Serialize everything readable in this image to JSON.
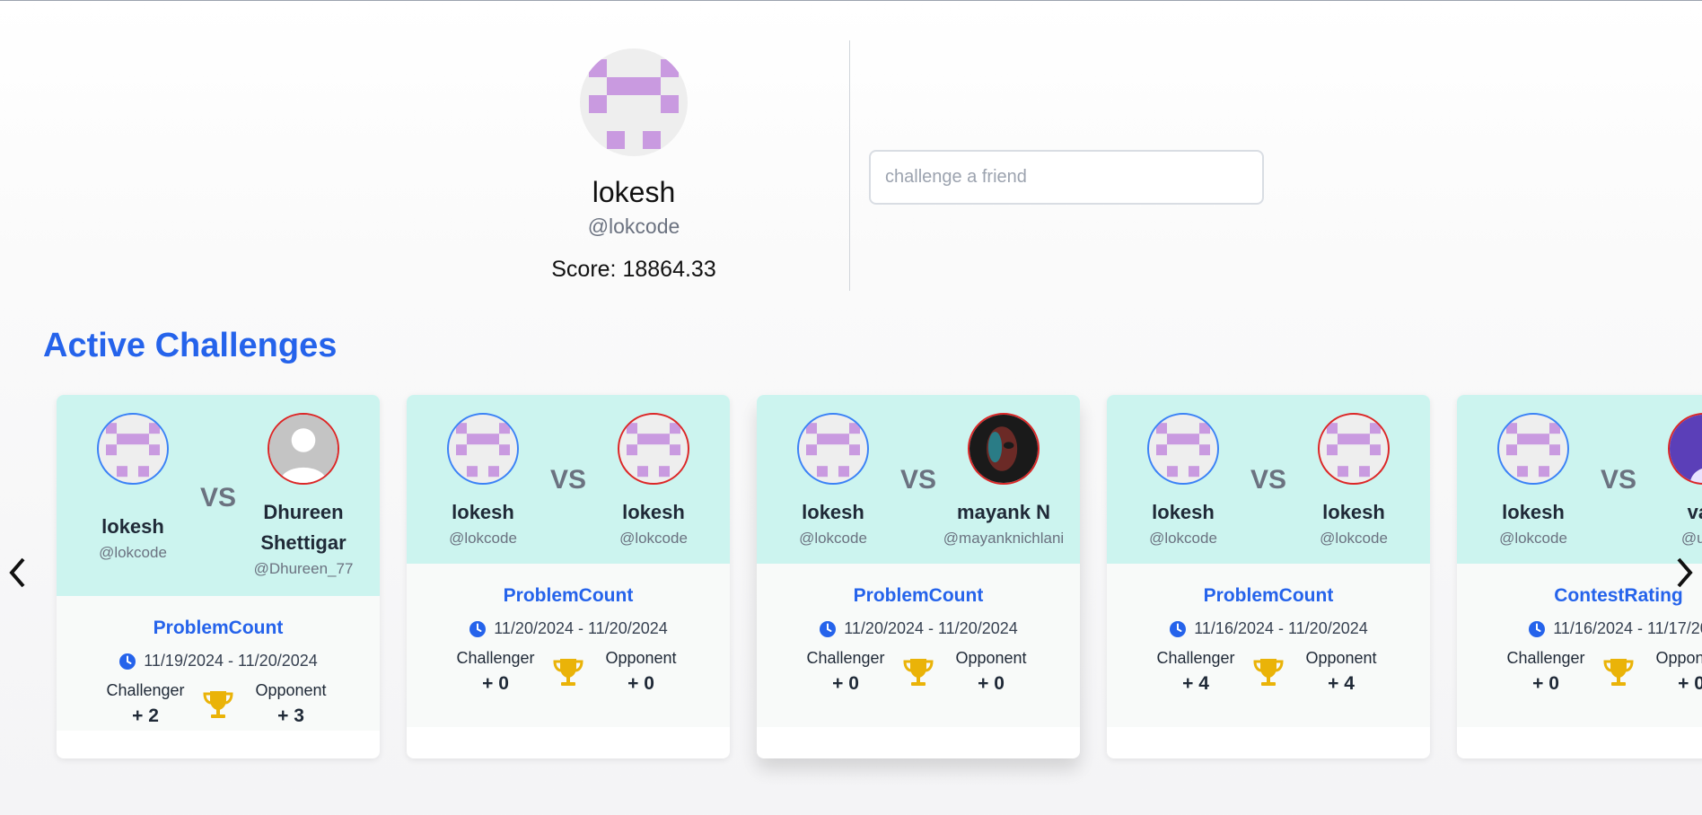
{
  "profile": {
    "name": "lokesh",
    "handle": "@lokcode",
    "score": "Score: 18864.33"
  },
  "search": {
    "placeholder": "challenge a friend",
    "value": ""
  },
  "section_title": "Active Challenges",
  "labels": {
    "vs": "VS",
    "challenger": "Challenger",
    "opponent": "Opponent"
  },
  "colors": {
    "accent": "#2563eb",
    "card_top": "#ccf4ef",
    "challenger_ring": "#3b82f6",
    "opponent_ring": "#dc2626",
    "trophy": "#eab308",
    "identicon": "#c99ae0"
  },
  "challenges": [
    {
      "challenger": {
        "name": "lokesh",
        "handle": "@lokcode",
        "avatar": "identicon"
      },
      "opponent": {
        "name": "Dhureen Shettigar",
        "handle": "@Dhureen_77",
        "avatar": "default-user-icon"
      },
      "type": "ProblemCount",
      "dates": "11/19/2024 - 11/20/2024",
      "challenger_score": "+ 2",
      "opponent_score": "+ 3"
    },
    {
      "challenger": {
        "name": "lokesh",
        "handle": "@lokcode",
        "avatar": "identicon"
      },
      "opponent": {
        "name": "lokesh",
        "handle": "@lokcode",
        "avatar": "identicon"
      },
      "type": "ProblemCount",
      "dates": "11/20/2024 - 11/20/2024",
      "challenger_score": "+ 0",
      "opponent_score": "+ 0"
    },
    {
      "challenger": {
        "name": "lokesh",
        "handle": "@lokcode",
        "avatar": "identicon"
      },
      "opponent": {
        "name": "mayank N",
        "handle": "@mayanknichlani",
        "avatar": "photo"
      },
      "type": "ProblemCount",
      "dates": "11/20/2024 - 11/20/2024",
      "challenger_score": "+ 0",
      "opponent_score": "+ 0"
    },
    {
      "challenger": {
        "name": "lokesh",
        "handle": "@lokcode",
        "avatar": "identicon"
      },
      "opponent": {
        "name": "lokesh",
        "handle": "@lokcode",
        "avatar": "identicon"
      },
      "type": "ProblemCount",
      "dates": "11/16/2024 - 11/20/2024",
      "challenger_score": "+ 4",
      "opponent_score": "+ 4"
    },
    {
      "challenger": {
        "name": "lokesh",
        "handle": "@lokcode",
        "avatar": "identicon"
      },
      "opponent": {
        "name": "vail",
        "handle": "@user",
        "avatar": "photo-purple"
      },
      "type": "ContestRating",
      "dates": "11/16/2024 - 11/17/20",
      "challenger_score": "+ 0",
      "opponent_score": "+ 0"
    }
  ],
  "nav": {
    "prev_icon": "chevron-left-icon",
    "next_icon": "chevron-right-icon"
  }
}
